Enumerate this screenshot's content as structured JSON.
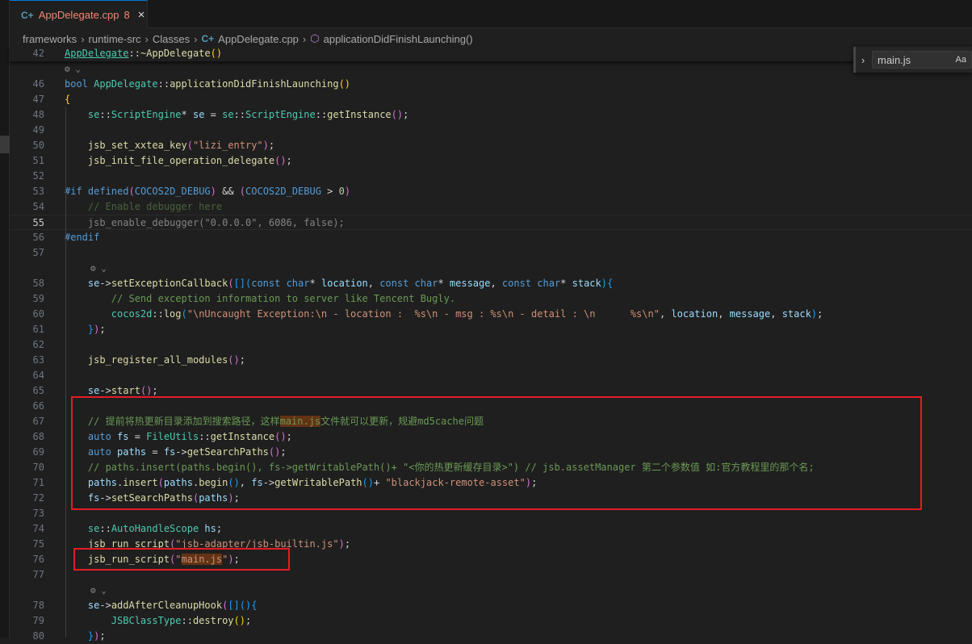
{
  "tab": {
    "icon": "cpp-file-icon",
    "name": "AppDelegate.cpp",
    "problems": "8",
    "close": "×"
  },
  "breadcrumb": [
    "frameworks",
    "runtime-src",
    "Classes",
    "AppDelegate.cpp",
    "applicationDidFinishLaunching()"
  ],
  "find": {
    "value": "main.js",
    "case_label": "Aa"
  },
  "colors": {
    "accent": "#0078d4",
    "highlight_box": "#e51b24",
    "find_match": "#623315"
  },
  "current_line": "55",
  "lines": [
    {
      "n": "42",
      "sticky": true,
      "t": [
        [
          "AppDelegate",
          "t u"
        ],
        [
          "::",
          "p"
        ],
        [
          "~AppDelegate",
          "f"
        ],
        [
          "()",
          "b1"
        ]
      ]
    },
    {
      "lens": true
    },
    {
      "n": "46",
      "t": [
        [
          "bool ",
          "k"
        ],
        [
          "AppDelegate",
          "t"
        ],
        [
          "::",
          "p"
        ],
        [
          "applicationDidFinishLaunching",
          "f"
        ],
        [
          "()",
          "b1"
        ]
      ]
    },
    {
      "n": "47",
      "t": [
        [
          "{",
          "b1"
        ]
      ]
    },
    {
      "n": "48",
      "t": [
        [
          "    se",
          "t"
        ],
        [
          "::",
          "p"
        ],
        [
          "ScriptEngine",
          "t"
        ],
        [
          "* ",
          "p"
        ],
        [
          "se",
          "v"
        ],
        [
          " = ",
          "p"
        ],
        [
          "se",
          "t"
        ],
        [
          "::",
          "p"
        ],
        [
          "ScriptEngine",
          "t"
        ],
        [
          "::",
          "p"
        ],
        [
          "getInstance",
          "f"
        ],
        [
          "()",
          "b2"
        ],
        [
          ";",
          "p"
        ]
      ]
    },
    {
      "n": "49",
      "t": []
    },
    {
      "n": "50",
      "t": [
        [
          "    jsb_set_xxtea_key",
          "f"
        ],
        [
          "(",
          "b2"
        ],
        [
          "\"lizi_entry\"",
          "s"
        ],
        [
          ")",
          "b2"
        ],
        [
          ";",
          "p"
        ]
      ]
    },
    {
      "n": "51",
      "t": [
        [
          "    jsb_init_file_operation_delegate",
          "f"
        ],
        [
          "()",
          "b2"
        ],
        [
          ";",
          "p"
        ]
      ]
    },
    {
      "n": "52",
      "t": []
    },
    {
      "n": "53",
      "t": [
        [
          "#if defined",
          "k"
        ],
        [
          "(",
          "b2"
        ],
        [
          "COCOS2D_DEBUG",
          "k"
        ],
        [
          ")",
          "b2"
        ],
        [
          " && ",
          "p"
        ],
        [
          "(",
          "b2"
        ],
        [
          "COCOS2D_DEBUG",
          "k"
        ],
        [
          " > ",
          "p"
        ],
        [
          "0",
          "n"
        ],
        [
          ")",
          "b2"
        ]
      ]
    },
    {
      "n": "54",
      "t": [
        [
          "    // Enable debugger here",
          "c dim"
        ]
      ]
    },
    {
      "n": "55",
      "t": [
        [
          "    jsb_enable_debugger(\"0.0.0.0\", 6086, false);",
          "p dim"
        ]
      ]
    },
    {
      "n": "56",
      "t": [
        [
          "#endif",
          "k"
        ]
      ]
    },
    {
      "n": "57",
      "t": []
    },
    {
      "lens": true
    },
    {
      "n": "58",
      "t": [
        [
          "    se",
          "v"
        ],
        [
          "->",
          "p"
        ],
        [
          "setExceptionCallback",
          "f"
        ],
        [
          "(",
          "b2"
        ],
        [
          "[]",
          "b3"
        ],
        [
          "(",
          "b3"
        ],
        [
          "const char",
          "k"
        ],
        [
          "* ",
          "p"
        ],
        [
          "location",
          "v"
        ],
        [
          ", ",
          "p"
        ],
        [
          "const char",
          "k"
        ],
        [
          "* ",
          "p"
        ],
        [
          "message",
          "v"
        ],
        [
          ", ",
          "p"
        ],
        [
          "const char",
          "k"
        ],
        [
          "* ",
          "p"
        ],
        [
          "stack",
          "v"
        ],
        [
          ")",
          "b3"
        ],
        [
          "{",
          "b3"
        ]
      ]
    },
    {
      "n": "59",
      "t": [
        [
          "        // Send exception information to server like Tencent Bugly.",
          "c"
        ]
      ]
    },
    {
      "n": "60",
      "t": [
        [
          "        cocos2d",
          "t"
        ],
        [
          "::",
          "p"
        ],
        [
          "log",
          "f"
        ],
        [
          "(",
          "b3"
        ],
        [
          "\"\\nUncaught Exception:\\n - location :  %s\\n - msg : %s\\n - detail : \\n      %s\\n\"",
          "s"
        ],
        [
          ", ",
          "p"
        ],
        [
          "location",
          "v"
        ],
        [
          ", ",
          "p"
        ],
        [
          "message",
          "v"
        ],
        [
          ", ",
          "p"
        ],
        [
          "stack",
          "v"
        ],
        [
          ")",
          "b3"
        ],
        [
          ";",
          "p"
        ]
      ]
    },
    {
      "n": "61",
      "t": [
        [
          "    }",
          "b3"
        ],
        [
          ")",
          "b2"
        ],
        [
          ";",
          "p"
        ]
      ]
    },
    {
      "n": "62",
      "t": []
    },
    {
      "n": "63",
      "t": [
        [
          "    jsb_register_all_modules",
          "f"
        ],
        [
          "()",
          "b2"
        ],
        [
          ";",
          "p"
        ]
      ]
    },
    {
      "n": "64",
      "t": []
    },
    {
      "n": "65",
      "t": [
        [
          "    se",
          "v"
        ],
        [
          "->",
          "p"
        ],
        [
          "start",
          "f"
        ],
        [
          "()",
          "b2"
        ],
        [
          ";",
          "p"
        ]
      ]
    },
    {
      "n": "66",
      "t": []
    },
    {
      "n": "67",
      "t": [
        [
          "    // 提前将热更新目录添加到搜索路径，这样",
          "c"
        ],
        [
          "main.js",
          "c hl"
        ],
        [
          "文件就可以更新，规避md5cache问题",
          "c"
        ]
      ]
    },
    {
      "n": "68",
      "t": [
        [
          "    auto ",
          "k"
        ],
        [
          "fs",
          "v"
        ],
        [
          " = ",
          "p"
        ],
        [
          "FileUtils",
          "t"
        ],
        [
          "::",
          "p"
        ],
        [
          "getInstance",
          "f"
        ],
        [
          "()",
          "b2"
        ],
        [
          ";",
          "p"
        ]
      ]
    },
    {
      "n": "69",
      "t": [
        [
          "    auto ",
          "k"
        ],
        [
          "paths",
          "v"
        ],
        [
          " = ",
          "p"
        ],
        [
          "fs",
          "v"
        ],
        [
          "->",
          "p"
        ],
        [
          "getSearchPaths",
          "f"
        ],
        [
          "()",
          "b2"
        ],
        [
          ";",
          "p"
        ]
      ]
    },
    {
      "n": "70",
      "t": [
        [
          "    // paths.insert(paths.begin(), fs->getWritablePath()+ \"<你的热更新缓存目录>\") // jsb.assetManager 第二个参数值 如:官方教程里的那个名;",
          "c"
        ]
      ]
    },
    {
      "n": "71",
      "t": [
        [
          "    paths",
          "v"
        ],
        [
          ".",
          "p"
        ],
        [
          "insert",
          "f"
        ],
        [
          "(",
          "b2"
        ],
        [
          "paths",
          "v"
        ],
        [
          ".",
          "p"
        ],
        [
          "begin",
          "f"
        ],
        [
          "()",
          "b3"
        ],
        [
          ", ",
          "p"
        ],
        [
          "fs",
          "v"
        ],
        [
          "->",
          "p"
        ],
        [
          "getWritablePath",
          "f"
        ],
        [
          "()",
          "b3"
        ],
        [
          "+ ",
          "p"
        ],
        [
          "\"blackjack-remote-asset\"",
          "s"
        ],
        [
          ")",
          "b2"
        ],
        [
          ";",
          "p"
        ]
      ]
    },
    {
      "n": "72",
      "t": [
        [
          "    fs",
          "v"
        ],
        [
          "->",
          "p"
        ],
        [
          "setSearchPaths",
          "f"
        ],
        [
          "(",
          "b2"
        ],
        [
          "paths",
          "v"
        ],
        [
          ")",
          "b2"
        ],
        [
          ";",
          "p"
        ]
      ]
    },
    {
      "n": "73",
      "t": []
    },
    {
      "n": "74",
      "t": [
        [
          "    se",
          "t"
        ],
        [
          "::",
          "p"
        ],
        [
          "AutoHandleScope",
          "t"
        ],
        [
          " hs",
          "v"
        ],
        [
          ";",
          "p"
        ]
      ]
    },
    {
      "n": "75",
      "t": [
        [
          "    jsb_run_script",
          "f"
        ],
        [
          "(",
          "b2"
        ],
        [
          "\"jsb-adapter/jsb-builtin.js\"",
          "s"
        ],
        [
          ")",
          "b2"
        ],
        [
          ";",
          "p"
        ]
      ]
    },
    {
      "n": "76",
      "t": [
        [
          "    jsb_run_script",
          "f"
        ],
        [
          "(",
          "b2"
        ],
        [
          "\"",
          "s"
        ],
        [
          "main.js",
          "s hl"
        ],
        [
          "\"",
          "s"
        ],
        [
          ")",
          "b2"
        ],
        [
          ";",
          "p"
        ]
      ]
    },
    {
      "n": "77",
      "t": []
    },
    {
      "lens": true
    },
    {
      "n": "78",
      "t": [
        [
          "    se",
          "v"
        ],
        [
          "->",
          "p"
        ],
        [
          "addAfterCleanupHook",
          "f"
        ],
        [
          "(",
          "b2"
        ],
        [
          "[]",
          "b3"
        ],
        [
          "()",
          "b3"
        ],
        [
          "{",
          "b3"
        ]
      ]
    },
    {
      "n": "79",
      "t": [
        [
          "        JSBClassType",
          "t"
        ],
        [
          "::",
          "p"
        ],
        [
          "destroy",
          "f"
        ],
        [
          "()",
          "b1"
        ],
        [
          ";",
          "p"
        ]
      ]
    },
    {
      "n": "80",
      "t": [
        [
          "    }",
          "b3"
        ],
        [
          ")",
          "b2"
        ],
        [
          ";",
          "p"
        ]
      ]
    }
  ]
}
